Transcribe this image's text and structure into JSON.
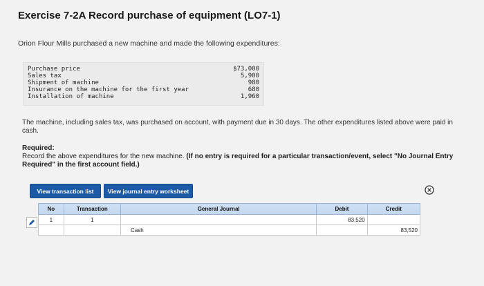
{
  "header": {
    "title": "Exercise 7-2A Record purchase of equipment (LO7-1)"
  },
  "intro": "Orion Flour Mills purchased a new machine and made the following expenditures:",
  "costs": [
    {
      "label": "Purchase price",
      "value": "$73,000"
    },
    {
      "label": "Sales tax",
      "value": "5,900"
    },
    {
      "label": "Shipment of machine",
      "value": "980"
    },
    {
      "label": "Insurance on the machine for the first year",
      "value": "680"
    },
    {
      "label": "Installation of machine",
      "value": "1,960"
    }
  ],
  "paragraph": "The machine, including sales tax, was purchased on account, with payment due in 30 days. The other expenditures listed above were paid in cash.",
  "required": {
    "heading": "Required:",
    "text": "Record the above expenditures for the new machine.",
    "note": "(If no entry is required for a particular transaction/event, select \"No Journal Entry Required\" in the first account field.)"
  },
  "buttons": {
    "view_transaction_list": "View transaction list",
    "view_journal_worksheet": "View journal entry worksheet"
  },
  "journal": {
    "columns": [
      "No",
      "Transaction",
      "General Journal",
      "Debit",
      "Credit"
    ],
    "rows": [
      {
        "no": "1",
        "transaction": "1",
        "account": "",
        "debit": "83,520",
        "credit": ""
      },
      {
        "no": "",
        "transaction": "",
        "account": "Cash",
        "debit": "",
        "credit": "83,520"
      }
    ]
  },
  "colors": {
    "button": "#1c5aa8",
    "header_row": "#c9dcf1",
    "background": "#f2f2f2"
  },
  "icons": {
    "close": "close-circle-icon",
    "edit": "pencil-icon"
  }
}
